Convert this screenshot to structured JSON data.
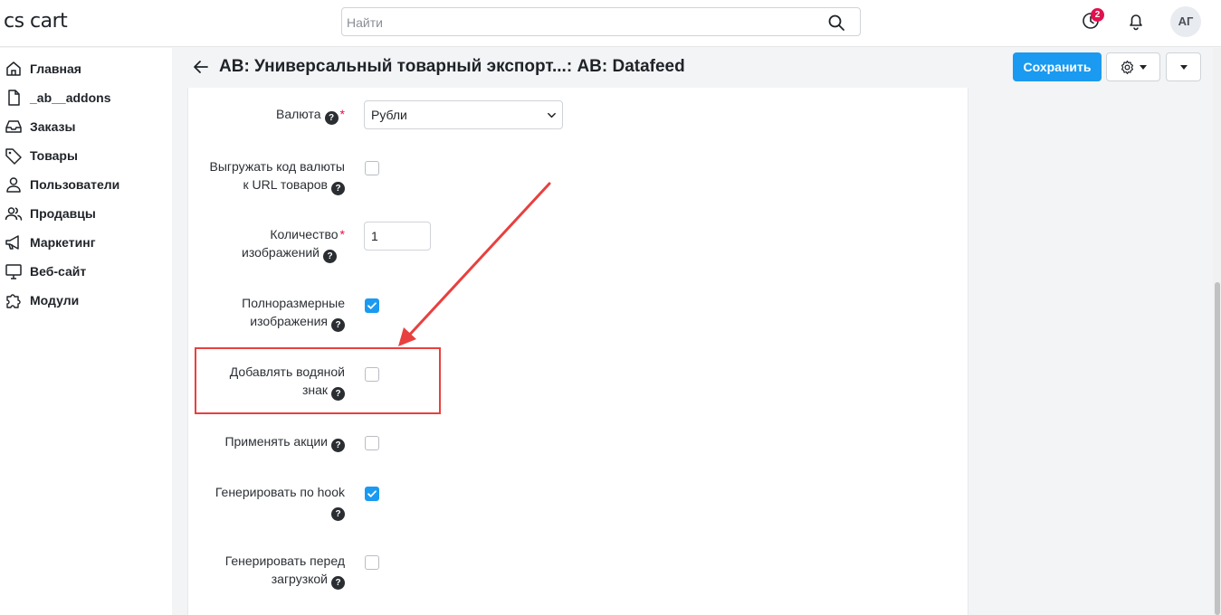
{
  "header": {
    "logo": "cs cart",
    "search_placeholder": "Найти",
    "notifications_count": "2",
    "avatar_initials": "АГ"
  },
  "sidebar": {
    "items": [
      {
        "label": "Главная",
        "icon": "home-icon"
      },
      {
        "label": "_ab__addons",
        "icon": "file-icon"
      },
      {
        "label": "Заказы",
        "icon": "inbox-icon"
      },
      {
        "label": "Товары",
        "icon": "tag-icon"
      },
      {
        "label": "Пользователи",
        "icon": "user-icon"
      },
      {
        "label": "Продавцы",
        "icon": "users-icon"
      },
      {
        "label": "Маркетинг",
        "icon": "megaphone-icon"
      },
      {
        "label": "Веб-сайт",
        "icon": "monitor-icon"
      },
      {
        "label": "Модули",
        "icon": "puzzle-icon"
      }
    ]
  },
  "page": {
    "title": "AB: Универсальный товарный экспорт...: AB: Datafeed",
    "save_label": "Сохранить"
  },
  "form": {
    "currency": {
      "label": "Валюта",
      "required_mark": "*",
      "value": "Рубли"
    },
    "export_currency_code": {
      "label_line1": "Выгружать код валюты",
      "label_line2": "к URL товаров",
      "checked": false
    },
    "images_count": {
      "label_line1": "Количество",
      "label_line2": "изображений",
      "required_mark": "*",
      "value": "1"
    },
    "full_size_images": {
      "label_line1": "Полноразмерные",
      "label_line2": "изображения",
      "checked": true
    },
    "add_watermark": {
      "label_line1": "Добавлять водяной",
      "label_line2": "знак",
      "checked": false
    },
    "apply_promotions": {
      "label": "Применять акции",
      "checked": false
    },
    "generate_by_hook": {
      "label": "Генерировать по hook",
      "checked": true
    },
    "generate_before_download": {
      "label_line1": "Генерировать перед",
      "label_line2": "загрузкой",
      "checked": false
    }
  },
  "colors": {
    "primary": "#1a9af0",
    "badge": "#e0114e",
    "annotation": "#e8403f"
  }
}
